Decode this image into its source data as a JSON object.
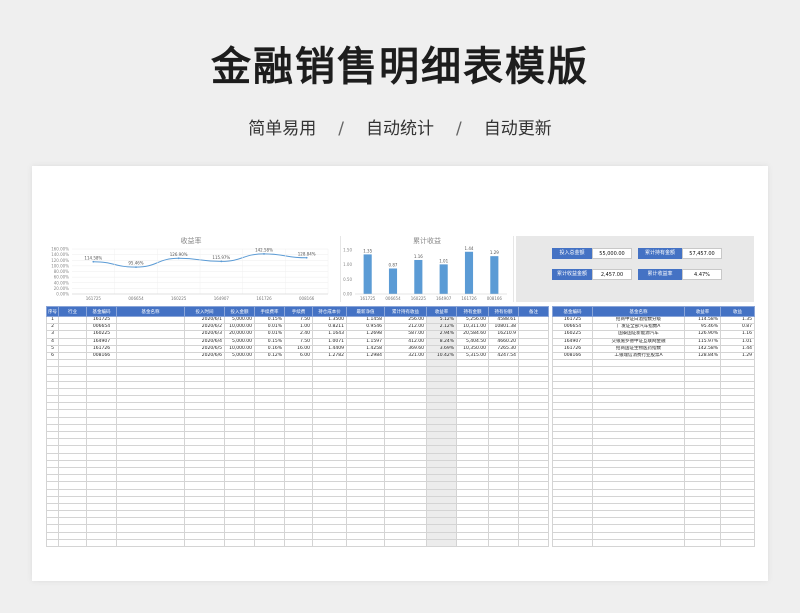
{
  "page": {
    "title": "金融销售明细表模版",
    "tags": [
      "简单易用",
      "自动统计",
      "自动更新"
    ],
    "separator": "/"
  },
  "line_chart": {
    "chart_data": {
      "type": "line",
      "title": "收益率",
      "categories": [
        "161725",
        "006654",
        "160225",
        "164907",
        "161726",
        "008166"
      ],
      "values": [
        114.58,
        95.46,
        126.9,
        115.97,
        142.58,
        128.84
      ],
      "data_labels": [
        "114.58%",
        "95.46%",
        "126.90%",
        "115.97%",
        "142.58%",
        "128.84%"
      ],
      "ytick_labels": [
        "160.00%",
        "140.00%",
        "120.00%",
        "100.00%",
        "80.00%",
        "60.00%",
        "40.00%",
        "20.00%",
        "0.00%"
      ],
      "ylim": [
        0,
        160
      ],
      "color": "#5b9bd5"
    }
  },
  "bar_chart": {
    "chart_data": {
      "type": "bar",
      "title": "累计收益",
      "categories": [
        "161725",
        "006654",
        "160225",
        "164907",
        "161726",
        "008166"
      ],
      "values": [
        1.35,
        0.87,
        1.16,
        1.01,
        1.44,
        1.29
      ],
      "data_labels": [
        "1.35",
        "0.87",
        "1.16",
        "1.01",
        "1.44",
        "1.29"
      ],
      "ytick_labels": [
        "1.50",
        "1.00",
        "0.50",
        "0.00"
      ],
      "ylim": [
        0,
        1.5
      ],
      "color": "#5b9bd5"
    }
  },
  "kpis": [
    {
      "label": "投入总金额",
      "value": "55,000.00"
    },
    {
      "label": "累计持有金额",
      "value": "57,457.00"
    },
    {
      "label": "累计收益金额",
      "value": "2,457.00"
    },
    {
      "label": "累计收益率",
      "value": "4.47%"
    }
  ],
  "main_table": {
    "headers": [
      "序号",
      "行业",
      "基金编码",
      "基金名称",
      "投入时间",
      "投入金额",
      "手续费率",
      "手续费",
      "持仓成本价",
      "最新净值",
      "累计持有收益",
      "收益率",
      "持有金额",
      "持有份额",
      "备注"
    ],
    "rows": [
      [
        "1",
        "",
        "161725",
        "",
        "2020/6/1",
        "5,000.00",
        "0.15%",
        "7.50",
        "1.3500",
        "1.1458",
        "256.00",
        "5.12%",
        "5,256.00",
        "4588.61",
        ""
      ],
      [
        "2",
        "",
        "006654",
        "",
        "2020/6/2",
        "10,000.00",
        "0.01%",
        "1.00",
        "0.8211",
        "0.9546",
        "212.00",
        "2.12%",
        "10,311.00",
        "10801.38",
        ""
      ],
      [
        "3",
        "",
        "160225",
        "",
        "2020/6/3",
        "20,000.00",
        "0.01%",
        "2.40",
        "1.1643",
        "1.2698",
        "587.00",
        "2.94%",
        "20,584.60",
        "16210.9",
        ""
      ],
      [
        "4",
        "",
        "164907",
        "",
        "2020/6/4",
        "5,000.00",
        "0.15%",
        "7.50",
        "1.0071",
        "1.1597",
        "412.00",
        "8.24%",
        "5,404.50",
        "4660.20",
        ""
      ],
      [
        "5",
        "",
        "161726",
        "",
        "2020/6/5",
        "10,000.00",
        "0.16%",
        "16.00",
        "1.4409",
        "1.4258",
        "369.60",
        "3.69%",
        "10,350.00",
        "7265.30",
        ""
      ],
      [
        "6",
        "",
        "008166",
        "",
        "2020/6/6",
        "5,000.00",
        "0.12%",
        "6.00",
        "1.2782",
        "1.2984",
        "321.00",
        "10.42%",
        "5,315.00",
        "4247.54",
        ""
      ]
    ]
  },
  "side_table": {
    "headers": [
      "基金编码",
      "基金名称",
      "收益率",
      "收益"
    ],
    "rows": [
      [
        "161725",
        "招商中证白酒指数分级",
        "114.58%",
        "1.35"
      ],
      [
        "006654",
        "广发证全部汽车指数A",
        "95.46%",
        "0.87"
      ],
      [
        "160225",
        "国泰国证新能源汽车",
        "126.90%",
        "1.16"
      ],
      [
        "164907",
        "交银施罗德中证互联网金融",
        "115.97%",
        "1.01"
      ],
      [
        "161726",
        "招商国证生物医药指数",
        "142.58%",
        "1.44"
      ],
      [
        "008166",
        "工银瑞信消费行业股票A",
        "128.84%",
        "1.29"
      ]
    ]
  }
}
